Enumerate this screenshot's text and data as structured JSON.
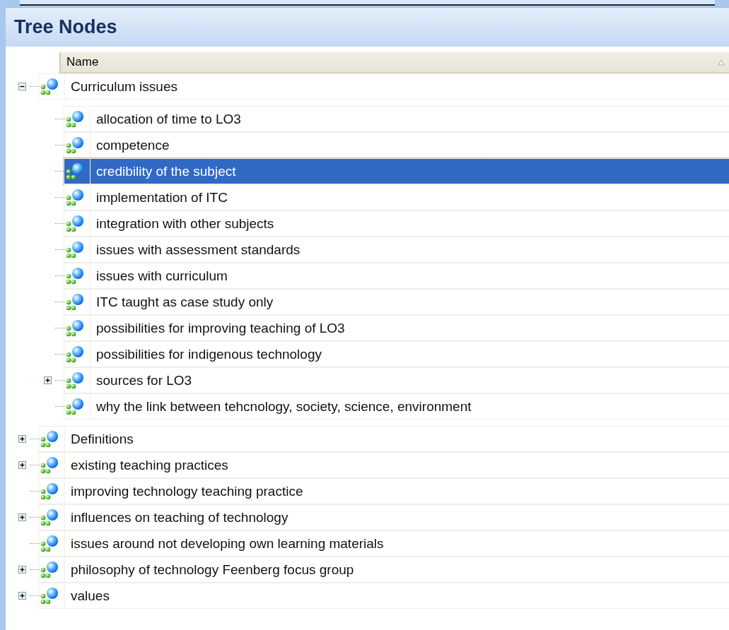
{
  "panel": {
    "title": "Tree Nodes"
  },
  "columns": [
    {
      "label": "Name"
    }
  ],
  "tree": [
    {
      "label": "Curriculum issues",
      "expanded": true,
      "selected": false,
      "children": [
        {
          "label": "allocation of time to LO3",
          "selected": false
        },
        {
          "label": "competence",
          "selected": false
        },
        {
          "label": "credibility of the subject",
          "selected": true
        },
        {
          "label": "implementation of ITC",
          "selected": false
        },
        {
          "label": "integration with other subjects",
          "selected": false
        },
        {
          "label": "issues with assessment standards",
          "selected": false
        },
        {
          "label": "issues with curriculum",
          "selected": false
        },
        {
          "label": "ITC taught as case study only",
          "selected": false
        },
        {
          "label": "possibilities for improving teaching of LO3",
          "selected": false
        },
        {
          "label": "possibilities for indigenous technology",
          "selected": false
        },
        {
          "label": "sources for LO3",
          "expanded": false,
          "selected": false
        },
        {
          "label": "why the link between tehcnology, society, science, environment",
          "selected": false
        }
      ]
    },
    {
      "label": "Definitions",
      "expanded": false,
      "selected": false
    },
    {
      "label": "existing teaching practices",
      "expanded": false,
      "selected": false
    },
    {
      "label": "improving technology teaching practice",
      "selected": false
    },
    {
      "label": "influences on teaching of technology",
      "expanded": false,
      "selected": false
    },
    {
      "label": "issues around not developing own learning materials",
      "selected": false
    },
    {
      "label": "philosophy of technology Feenberg focus group",
      "expanded": false,
      "selected": false
    },
    {
      "label": "values",
      "expanded": false,
      "selected": false
    }
  ]
}
